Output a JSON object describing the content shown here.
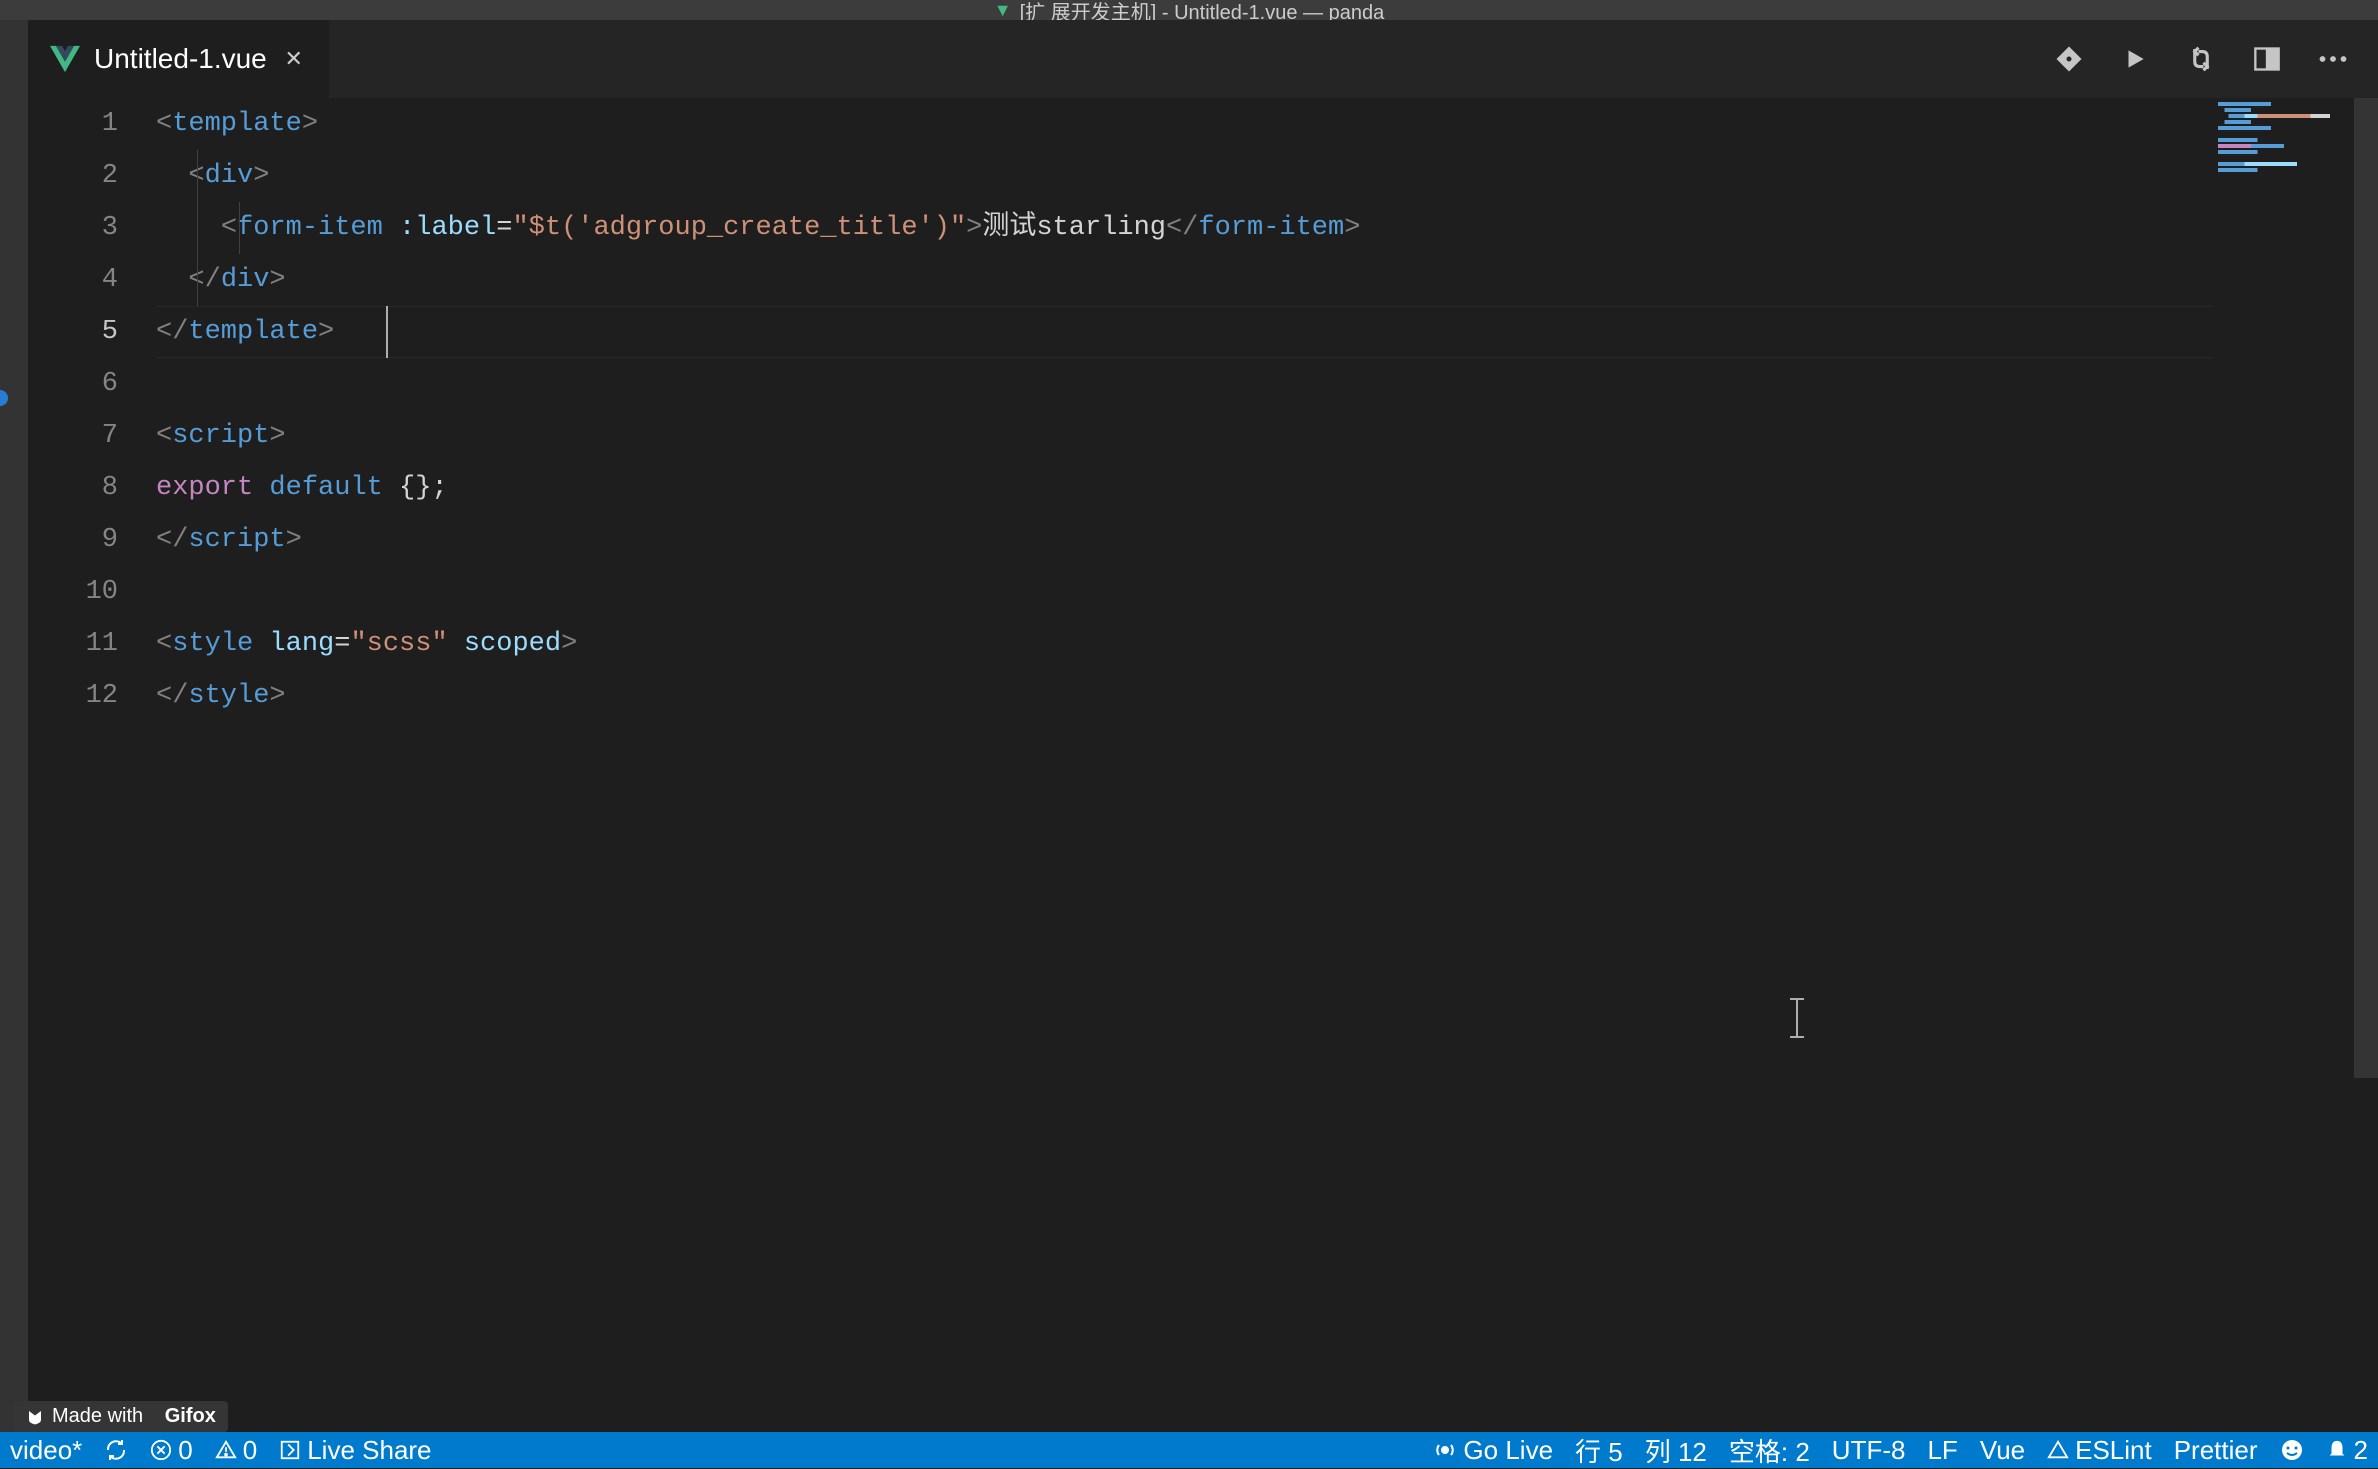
{
  "titlebar": {
    "text": "[扩 展开发主机] - Untitled-1.vue — panda"
  },
  "tab": {
    "filename": "Untitled-1.vue"
  },
  "editor": {
    "lines": 12,
    "activeLine": 5,
    "cursorCol": 12,
    "code": {
      "l1": {
        "tag": "template"
      },
      "l2": {
        "tag": "div"
      },
      "l3": {
        "tag1": "form-item",
        "attr": ":label",
        "eq": "=",
        "str": "\"$t('adgroup_create_title')\"",
        "text": "测试starling",
        "tag2": "form-item"
      },
      "l4": {
        "tag": "div"
      },
      "l5": {
        "tag": "template"
      },
      "l7": {
        "tag": "script"
      },
      "l8": {
        "kw1": "export",
        "kw2": "default",
        "rest": " {};"
      },
      "l9": {
        "tag": "script"
      },
      "l11": {
        "tag": "style",
        "attr1": "lang",
        "eq": "=",
        "str": "\"scss\"",
        "attr2": "scoped"
      },
      "l12": {
        "tag": "style"
      }
    }
  },
  "statusbar": {
    "leftItems": {
      "video": "video*",
      "errors": "0",
      "warnings": "0",
      "liveshare": "Live Share"
    },
    "rightItems": {
      "golive": "Go Live",
      "line": "行 5",
      "col": "列 12",
      "indent": "空格: 2",
      "encoding": "UTF-8",
      "eol": "LF",
      "language": "Vue",
      "eslint": "ESLint",
      "prettier": "Prettier",
      "bellCount": "2"
    }
  },
  "watermark": {
    "text": "Made with",
    "brand": "Gifox"
  }
}
